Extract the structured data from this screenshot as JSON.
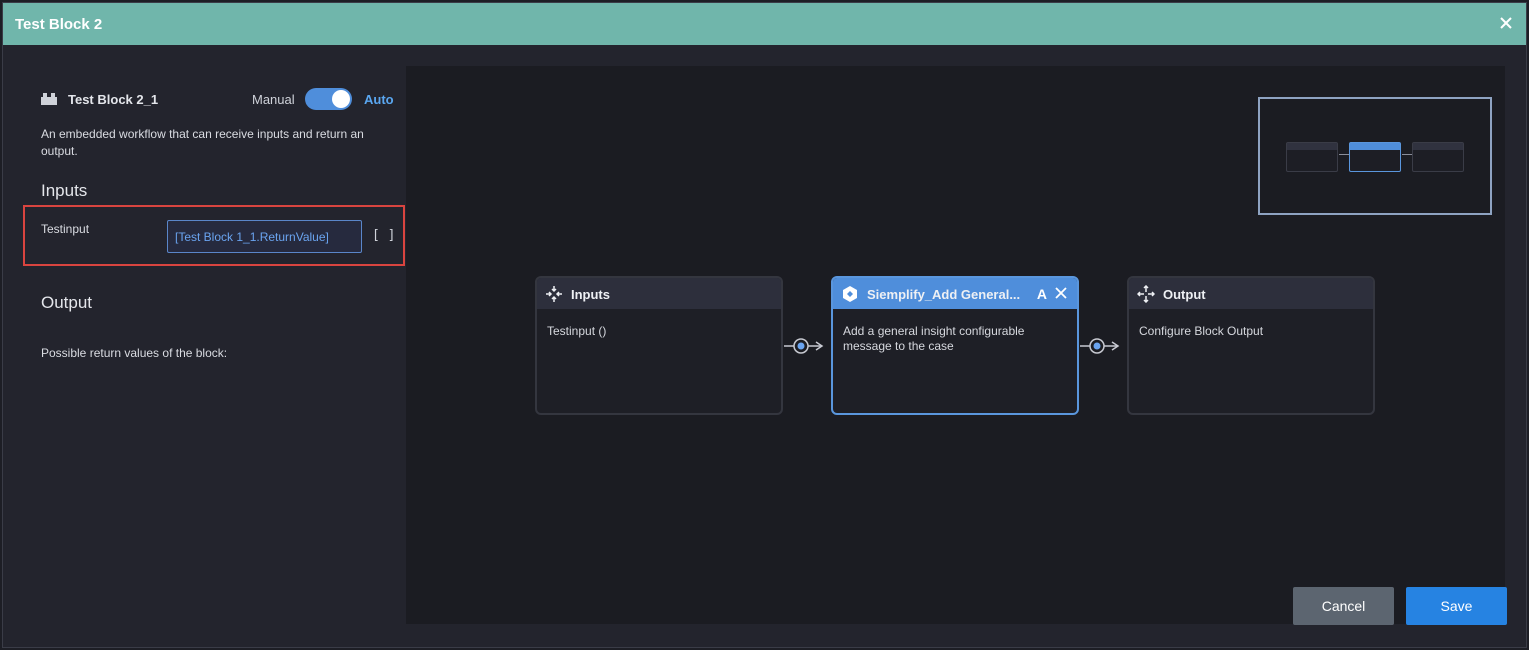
{
  "dialog": {
    "title": "Test Block 2"
  },
  "block": {
    "name": "Test Block 2_1",
    "mode_manual": "Manual",
    "mode_auto": "Auto",
    "mode_selected": "Auto",
    "description": "An embedded workflow that can receive inputs and return an output."
  },
  "inputs": {
    "heading": "Inputs",
    "items": [
      {
        "label": "Testinput",
        "value": "[Test Block 1_1.ReturnValue]",
        "list_button": "[ ]"
      }
    ]
  },
  "output": {
    "heading": "Output",
    "text": "Possible return values of the block:"
  },
  "nodes": [
    {
      "title": "Inputs",
      "body": "Testinput ()",
      "icon": "arrows-in-icon"
    },
    {
      "title": "Siemplify_Add General...",
      "body": "Add a general insight configurable message to the case",
      "icon": "siemplify-logo-icon",
      "selected": true,
      "ctl_a": "A"
    },
    {
      "title": "Output",
      "body": "Configure Block Output",
      "icon": "arrows-out-icon"
    }
  ],
  "buttons": {
    "cancel": "Cancel",
    "save": "Save"
  },
  "colors": {
    "titlebar": "#70b6ab",
    "accent": "#4f8edb",
    "highlight": "#d9443f",
    "save": "#2683e2"
  }
}
